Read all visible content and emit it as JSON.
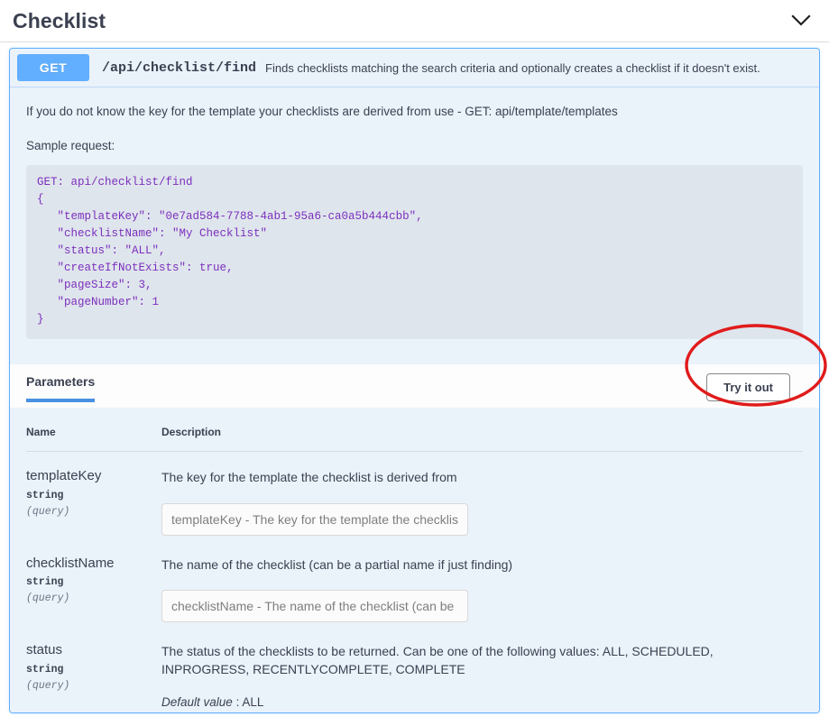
{
  "tag": {
    "title": "Checklist",
    "collapse_icon": "chevron-down-icon"
  },
  "operation": {
    "method": "GET",
    "path": "/api/checklist/find",
    "summary": "Finds checklists matching the search criteria and optionally creates a checklist if it doesn't exist.",
    "method_color": "#61affe",
    "border_color": "#61affe",
    "description_note": "If you do not know the key for the template your checklists are derived from use - GET: api/template/templates",
    "sample_label": "Sample request:",
    "sample_code": "GET: api/checklist/find\n{\n   \"templateKey\": \"0e7ad584-7788-4ab1-95a6-ca0a5b444cbb\",\n   \"checklistName\": \"My Checklist\"\n   \"status\": \"ALL\",\n   \"createIfNotExists\": true,\n   \"pageSize\": 3,\n   \"pageNumber\": 1\n}"
  },
  "tabs": {
    "parameters_label": "Parameters",
    "try_it_out_label": "Try it out",
    "active_underline_color": "#4990e2"
  },
  "params_table": {
    "headers": {
      "name": "Name",
      "description": "Description"
    },
    "rows": [
      {
        "name": "templateKey",
        "type": "string",
        "in": "(query)",
        "description": "The key for the template the checklist is derived from",
        "input_placeholder": "templateKey - The key for the template the checklist is derived from",
        "input_value": "",
        "has_input": true,
        "default_label": "",
        "default_value": ""
      },
      {
        "name": "checklistName",
        "type": "string",
        "in": "(query)",
        "description": "The name of the checklist (can be a partial name if just finding)",
        "input_placeholder": "checklistName - The name of the checklist (can be a partial name if just finding)",
        "input_value": "",
        "has_input": true,
        "default_label": "",
        "default_value": ""
      },
      {
        "name": "status",
        "type": "string",
        "in": "(query)",
        "description": "The status of the checklists to be returned. Can be one of the following values: ALL, SCHEDULED, INPROGRESS, RECENTLYCOMPLETE, COMPLETE",
        "input_placeholder": "",
        "input_value": "",
        "has_input": false,
        "default_label": "Default value",
        "default_value": "ALL"
      }
    ]
  },
  "annotation": {
    "shape": "ellipse",
    "color": "#e01b1b",
    "target": "Try it out"
  }
}
